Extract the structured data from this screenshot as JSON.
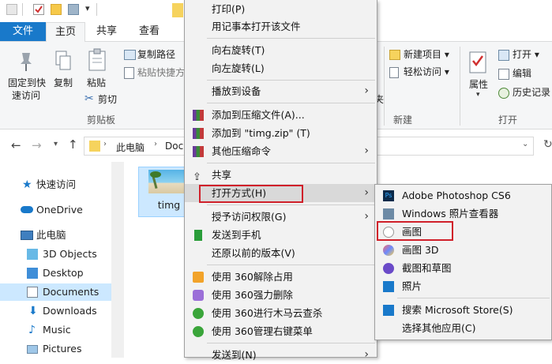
{
  "ribbon": {
    "tabs": [
      "文件",
      "主页",
      "共享",
      "查看"
    ],
    "pin_quick_access": [
      "固定到快",
      "速访问"
    ],
    "copy": "复制",
    "paste": "粘贴",
    "copy_path": "复制路径",
    "paste_shortcut": "粘贴快捷方",
    "cut": "剪切",
    "group_clipboard": "剪贴板",
    "new_item": "新建项目",
    "easy_access": "轻松访问",
    "group_new": "新建",
    "properties": "属性",
    "open": "打开",
    "edit": "编辑",
    "history": "历史记录",
    "group_open": "打开",
    "partial_char": "夹"
  },
  "address": {
    "crumbs": [
      "此电脑",
      "Doc"
    ]
  },
  "nav": {
    "items": [
      "快速访问",
      "OneDrive",
      "此电脑",
      "3D Objects",
      "Desktop",
      "Documents",
      "Downloads",
      "Music",
      "Pictures"
    ]
  },
  "file": {
    "name": "timg"
  },
  "context_menu": {
    "items": [
      "打印(P)",
      "用记事本打开该文件",
      "向右旋转(T)",
      "向左旋转(L)",
      "播放到设备",
      "添加到压缩文件(A)...",
      "添加到 \"timg.zip\" (T)",
      "其他压缩命令",
      "共享",
      "打开方式(H)",
      "授予访问权限(G)",
      "发送到手机",
      "还原以前的版本(V)",
      "使用 360解除占用",
      "使用 360强力删除",
      "使用 360进行木马云查杀",
      "使用 360管理右键菜单",
      "发送到(N)"
    ]
  },
  "submenu": {
    "items": [
      "Adobe Photoshop CS6",
      "Windows 照片查看器",
      "画图",
      "画图 3D",
      "截图和草图",
      "照片",
      "搜索 Microsoft Store(S)",
      "选择其他应用(C)"
    ]
  },
  "colors": {
    "accent": "#1979ca",
    "selection": "#cce8ff",
    "highlight_box": "#d0202a"
  }
}
